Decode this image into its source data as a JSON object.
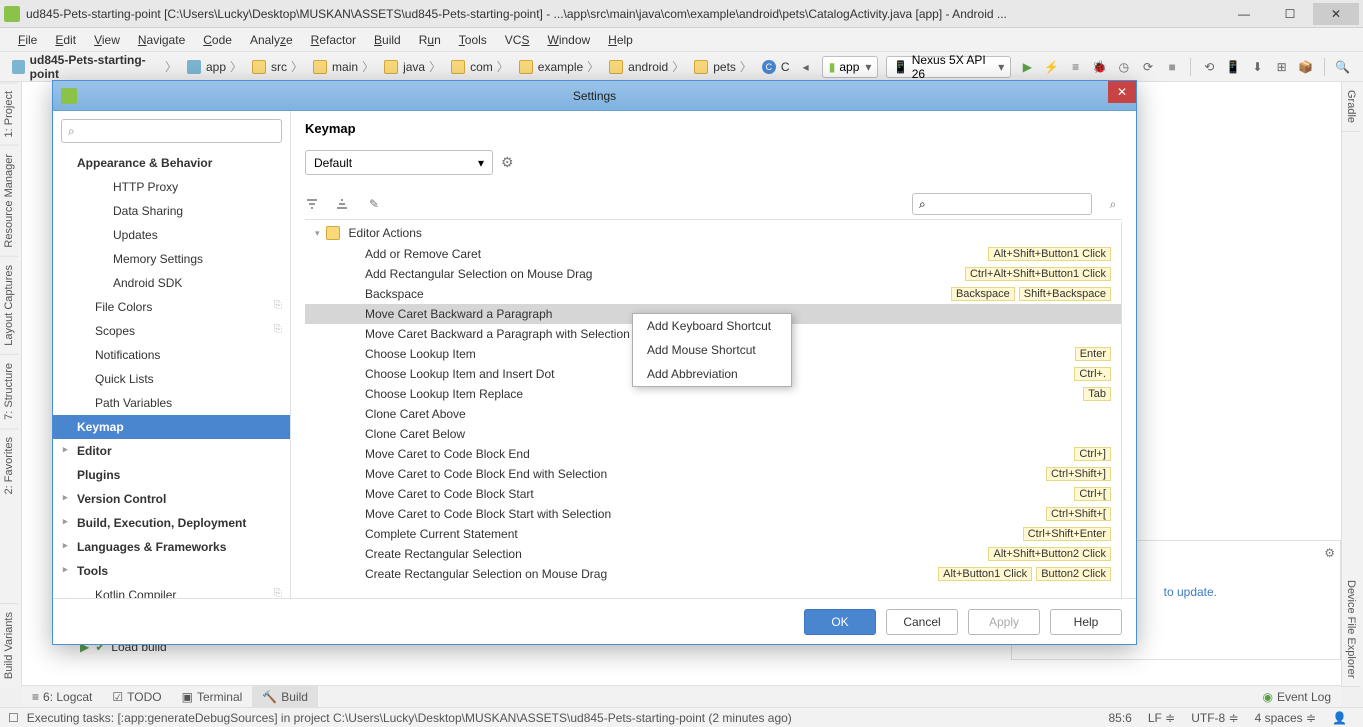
{
  "window": {
    "title": "ud845-Pets-starting-point [C:\\Users\\Lucky\\Desktop\\MUSKAN\\ASSETS\\ud845-Pets-starting-point] - ...\\app\\src\\main\\java\\com\\example\\android\\pets\\CatalogActivity.java [app] - Android ..."
  },
  "menu": [
    "File",
    "Edit",
    "View",
    "Navigate",
    "Code",
    "Analyze",
    "Refactor",
    "Build",
    "Run",
    "Tools",
    "VCS",
    "Window",
    "Help"
  ],
  "crumbs": [
    "ud845-Pets-starting-point",
    "app",
    "src",
    "main",
    "java",
    "com",
    "example",
    "android",
    "pets",
    "C"
  ],
  "runconf": {
    "name": "app",
    "device": "Nexus 5X API 26"
  },
  "side_left": [
    "1: Project",
    "Resource Manager",
    "Layout Captures",
    "7: Structure",
    "2: Favorites",
    "Build Variants"
  ],
  "side_right": [
    "Gradle",
    "Device File Explorer"
  ],
  "bottom_tabs": [
    "6: Logcat",
    "TODO",
    "Terminal",
    "Build"
  ],
  "status": {
    "task": "Executing tasks: [:app:generateDebugSources] in project C:\\Users\\Lucky\\Desktop\\MUSKAN\\ASSETS\\ud845-Pets-starting-point (2 minutes ago)",
    "pos": "85:6",
    "lf": "LF",
    "enc": "UTF-8",
    "indent": "4 spaces",
    "eventlog": "Event Log"
  },
  "build": "Load build",
  "hint": "to update.",
  "dialog": {
    "title": "Settings",
    "tree": {
      "grp_appearance": "Appearance & Behavior",
      "http_proxy": "HTTP Proxy",
      "data_sharing": "Data Sharing",
      "updates": "Updates",
      "mem": "Memory Settings",
      "sdk": "Android SDK",
      "filecolors": "File Colors",
      "scopes": "Scopes",
      "notif": "Notifications",
      "quicklists": "Quick Lists",
      "pathvars": "Path Variables",
      "keymap": "Keymap",
      "editor": "Editor",
      "plugins": "Plugins",
      "vc": "Version Control",
      "bed": "Build, Execution, Deployment",
      "lang": "Languages & Frameworks",
      "tools": "Tools",
      "kotlin": "Kotlin Compiler"
    },
    "right_title": "Keymap",
    "keymap_sel": "Default",
    "group": "Editor Actions",
    "actions": [
      {
        "label": "Add or Remove Caret",
        "sc": [
          "Alt+Shift+Button1 Click"
        ]
      },
      {
        "label": "Add Rectangular Selection on Mouse Drag",
        "sc": [
          "Ctrl+Alt+Shift+Button1 Click"
        ]
      },
      {
        "label": "Backspace",
        "sc": [
          "Backspace",
          "Shift+Backspace"
        ]
      },
      {
        "label": "Move Caret Backward a Paragraph",
        "sc": [],
        "sel": true
      },
      {
        "label": "Move Caret Backward a Paragraph with Selection",
        "sc": []
      },
      {
        "label": "Choose Lookup Item",
        "sc": [
          "Enter"
        ]
      },
      {
        "label": "Choose Lookup Item and Insert Dot",
        "sc": [
          "Ctrl+."
        ]
      },
      {
        "label": "Choose Lookup Item Replace",
        "sc": [
          "Tab"
        ]
      },
      {
        "label": "Clone Caret Above",
        "sc": []
      },
      {
        "label": "Clone Caret Below",
        "sc": []
      },
      {
        "label": "Move Caret to Code Block End",
        "sc": [
          "Ctrl+]"
        ]
      },
      {
        "label": "Move Caret to Code Block End with Selection",
        "sc": [
          "Ctrl+Shift+]"
        ]
      },
      {
        "label": "Move Caret to Code Block Start",
        "sc": [
          "Ctrl+["
        ]
      },
      {
        "label": "Move Caret to Code Block Start with Selection",
        "sc": [
          "Ctrl+Shift+["
        ]
      },
      {
        "label": "Complete Current Statement",
        "sc": [
          "Ctrl+Shift+Enter"
        ]
      },
      {
        "label": "Create Rectangular Selection",
        "sc": [
          "Alt+Shift+Button2 Click"
        ]
      },
      {
        "label": "Create Rectangular Selection on Mouse Drag",
        "sc": [
          "Alt+Button1 Click",
          "Button2 Click"
        ]
      }
    ],
    "context": [
      "Add Keyboard Shortcut",
      "Add Mouse Shortcut",
      "Add Abbreviation"
    ],
    "btn_ok": "OK",
    "btn_cancel": "Cancel",
    "btn_apply": "Apply",
    "btn_help": "Help"
  }
}
